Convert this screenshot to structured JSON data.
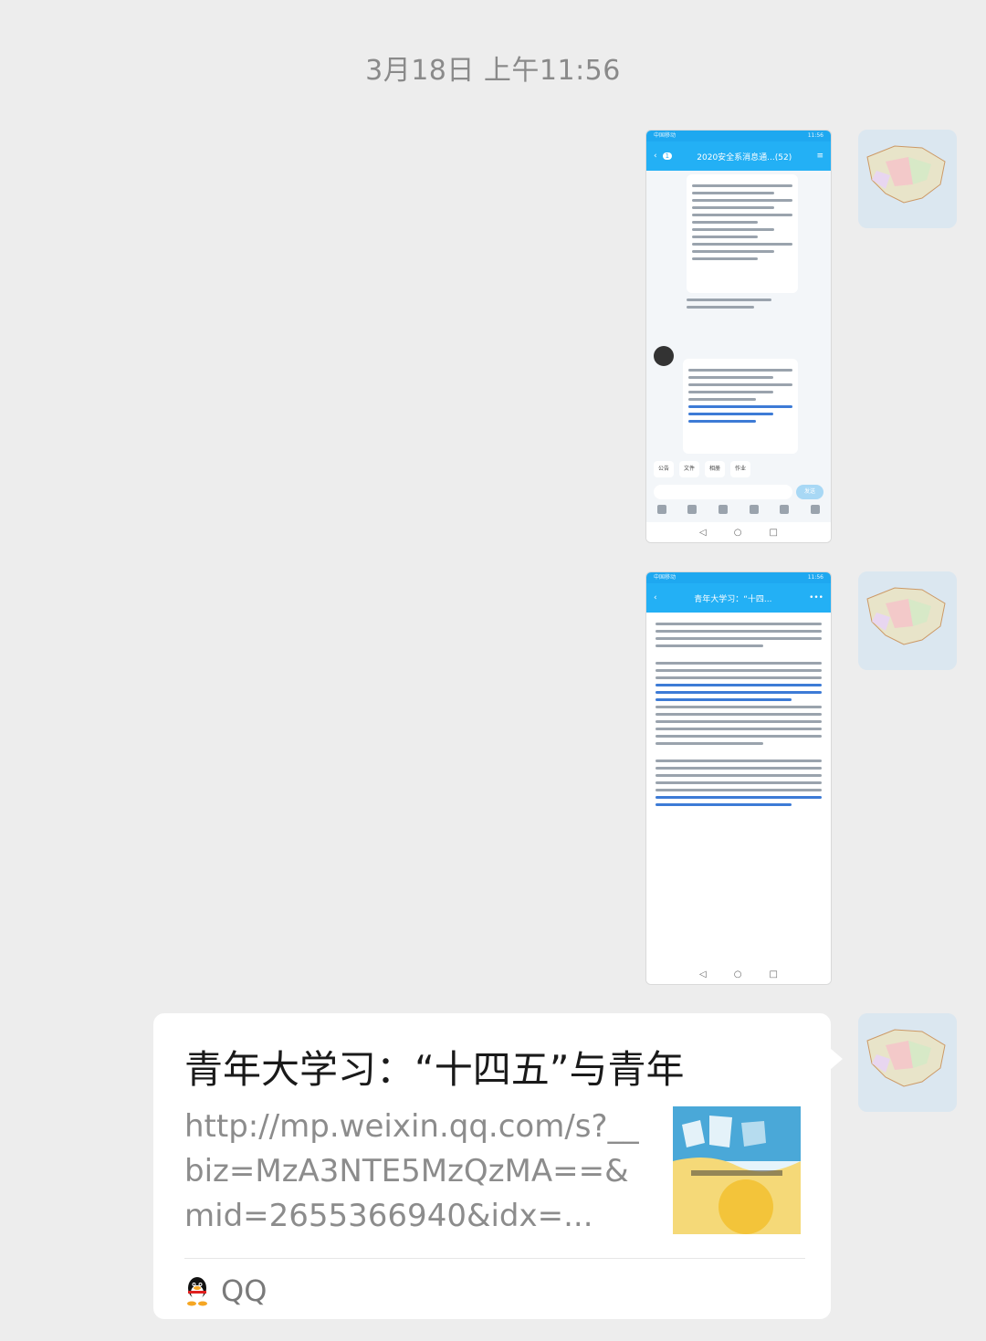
{
  "timestamp": "3月18日 上午11:56",
  "messages": [
    {
      "type": "screenshot",
      "description": "QQ group chat screenshot",
      "status_left": "中国移动",
      "status_right": "11:56",
      "title": "2020安全系消息通...(52)",
      "badge": "1",
      "chips": [
        "公告",
        "文件",
        "相册",
        "作业"
      ],
      "send": "发送"
    },
    {
      "type": "screenshot",
      "description": "article screenshot",
      "status_left": "中国移动",
      "status_right": "11:56",
      "title": "青年大学习：“十四..."
    }
  ],
  "link_card": {
    "title": "青年大学习：“十四五”与青年",
    "url": "http://mp.weixin.qq.com/s?__biz=MzA3NTE5MzQzMA==&mid=2655366940&idx=...",
    "source": "QQ"
  }
}
